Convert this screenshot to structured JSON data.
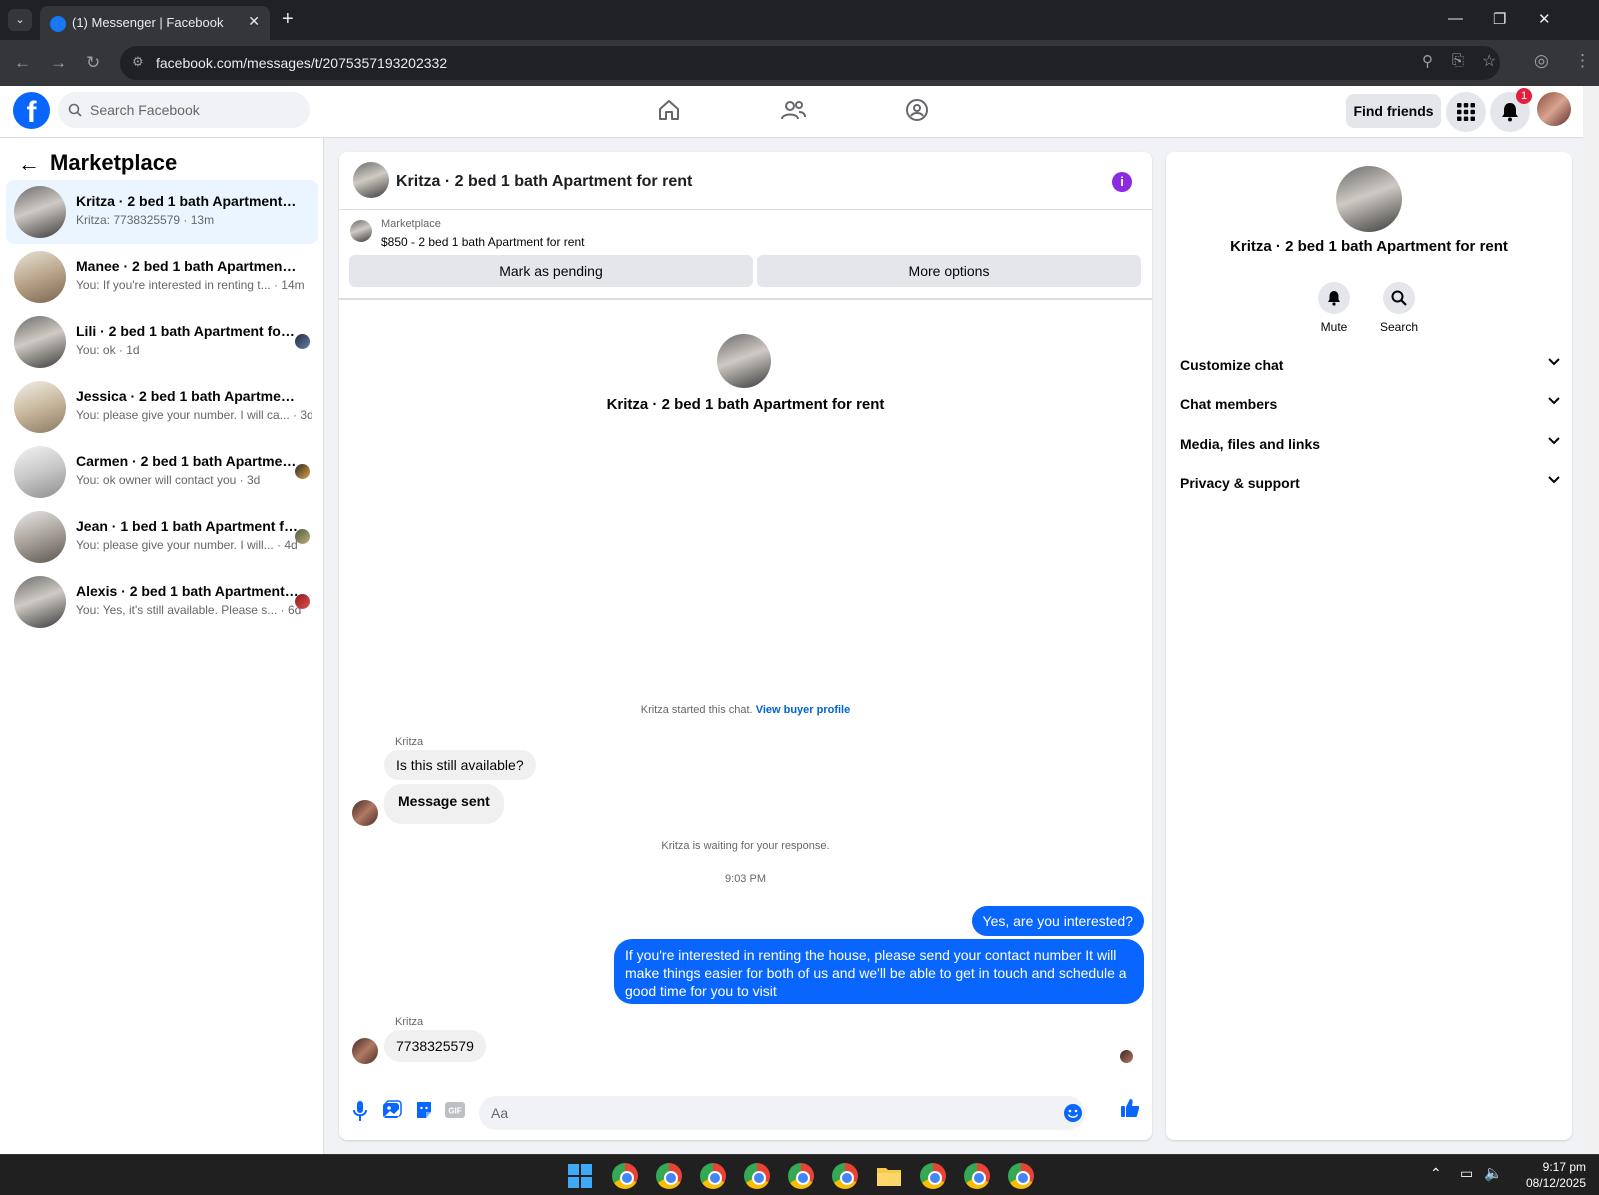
{
  "browser": {
    "tab_title": "(1) Messenger | Facebook",
    "url": "facebook.com/messages/t/2075357193202332",
    "new_tab": "+",
    "close_tab": "✕"
  },
  "header": {
    "search_placeholder": "Search Facebook",
    "find_friends": "Find friends",
    "notification_count": "1"
  },
  "sidebar": {
    "title": "Marketplace",
    "conversations": [
      {
        "name": "Kritza · 2 bed 1 bath Apartment for rent",
        "snippet": "Kritza: 7738325579 · 13m",
        "selected": true
      },
      {
        "name": "Manee · 2 bed 1 bath Apartment for rent",
        "snippet": "You: If you're interested in renting t... · 14m"
      },
      {
        "name": "Lili · 2 bed 1 bath Apartment for rent",
        "snippet": "You: ok · 1d"
      },
      {
        "name": "Jessica · 2 bed 1 bath Apartment for rent",
        "snippet": "You: please give your number. I will ca... · 3d"
      },
      {
        "name": "Carmen · 2 bed 1 bath Apartment for rent",
        "snippet": "You: ok owner will contact you · 3d"
      },
      {
        "name": "Jean · 1 bed 1 bath Apartment for rent",
        "snippet": "You: please give your number. I will... · 4d"
      },
      {
        "name": "Alexis · 2 bed 1 bath Apartment for rent",
        "snippet": "You: Yes, it's still available. Please s... · 6d"
      }
    ]
  },
  "chat": {
    "title": "Kritza · 2 bed 1 bath Apartment for rent",
    "marketplace_label": "Marketplace",
    "listing": "$850 - 2 bed 1 bath Apartment for rent",
    "mark_pending": "Mark as pending",
    "more_options": "More options",
    "profile_name": "Kritza · 2 bed 1 bath Apartment for rent",
    "started_text": "Kritza started this chat.",
    "view_profile": "View buyer profile",
    "sender": "Kritza",
    "msg1": "Is this still available?",
    "msg2": "Message sent",
    "waiting": "Kritza is waiting for your response.",
    "time": "9:03 PM",
    "out1": "Yes, are you interested?",
    "out2": "If you're interested in renting the house, please send your contact number It will make things easier for both of us and we'll be able to get in touch and schedule a good time for you to visit",
    "sender2": "Kritza",
    "msg3": "7738325579",
    "composer_placeholder": "Aa"
  },
  "details": {
    "name": "Kritza · 2 bed 1 bath Apartment for rent",
    "mute": "Mute",
    "search": "Search",
    "sections": [
      "Customize chat",
      "Chat members",
      "Media, files and links",
      "Privacy & support"
    ]
  },
  "taskbar": {
    "time": "9:17 pm",
    "date": "08/12/2025"
  },
  "colors": {
    "brand": "#0866ff",
    "info": "#8a2be2",
    "badge": "#e41e3f"
  }
}
